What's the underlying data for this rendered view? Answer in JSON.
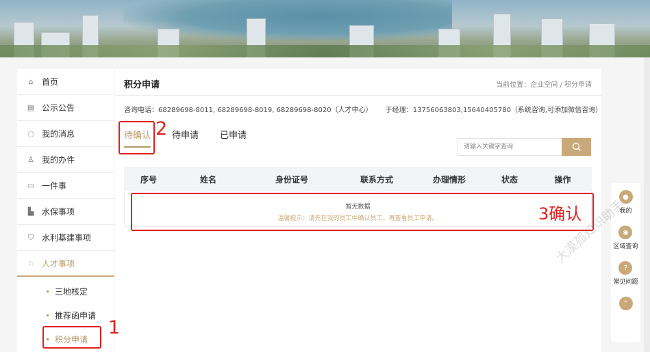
{
  "sidebar": {
    "items": [
      {
        "label": "首页",
        "icon": "home-icon",
        "glyph": "⌂"
      },
      {
        "label": "公示公告",
        "icon": "notice-icon",
        "glyph": "▤"
      },
      {
        "label": "我的消息",
        "icon": "message-icon",
        "glyph": "◌"
      },
      {
        "label": "我的办件",
        "icon": "user-file-icon",
        "glyph": "♙"
      },
      {
        "label": "一件事",
        "icon": "task-icon",
        "glyph": "▭"
      },
      {
        "label": "水保事项",
        "icon": "water-icon",
        "glyph": "▙"
      },
      {
        "label": "水利基建事项",
        "icon": "construction-icon",
        "glyph": "⛉"
      },
      {
        "label": "人才事项",
        "icon": "talent-icon",
        "glyph": "♘"
      }
    ],
    "sub_items": [
      {
        "label": "三地核定"
      },
      {
        "label": "推荐函申请"
      },
      {
        "label": "积分申请"
      }
    ]
  },
  "main": {
    "title": "积分申请",
    "breadcrumb": "当前位置：企业空间 / 积分申请",
    "contact_phone": "咨询电话：68289698-8011, 68289698-8019, 68289698-8020（人才中心）",
    "contact_manager": "于经理：13756063803,15640405780（系统咨询,可添加微信咨询）",
    "tabs": [
      {
        "label": "待确认"
      },
      {
        "label": "待申请"
      },
      {
        "label": "已申请"
      }
    ],
    "search": {
      "placeholder": "请输入关键字查询"
    },
    "table": {
      "headers": [
        "序号",
        "姓名",
        "身份证号",
        "联系方式",
        "办理情形",
        "状态",
        "操作"
      ],
      "empty_text": "暂无数据",
      "hint_text": "温馨提示：请先在我的员工中确认员工，再查看员工申请。"
    }
  },
  "annotations": {
    "n1": "1",
    "n2": "2",
    "n3": "3确认"
  },
  "float_tools": [
    {
      "label": "我的",
      "icon": "profile-icon",
      "glyph": "●"
    },
    {
      "label": "区域查询",
      "icon": "location-icon",
      "glyph": "◉"
    },
    {
      "label": "常见问题",
      "icon": "faq-icon",
      "glyph": "?"
    },
    {
      "label": "",
      "icon": "back-to-top-icon",
      "glyph": "⌃"
    }
  ],
  "watermark": "大漠孤知识助手"
}
